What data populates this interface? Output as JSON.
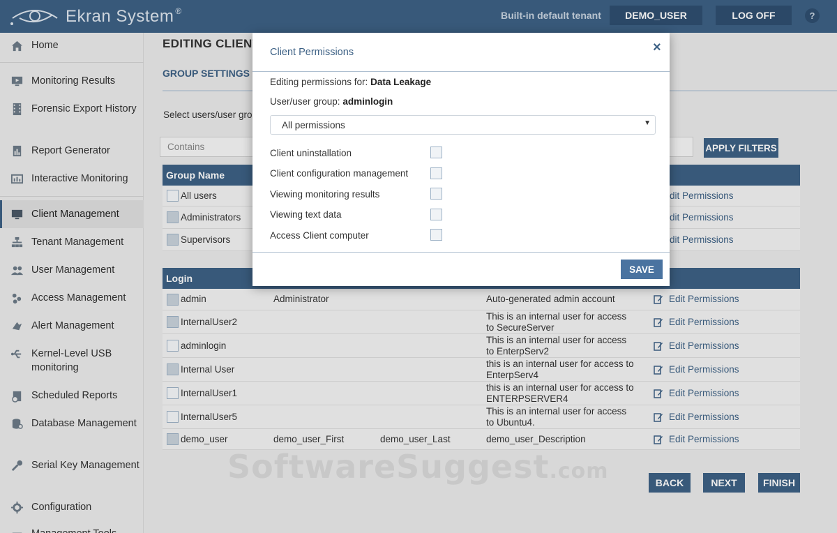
{
  "header": {
    "logo_text": "Ekran System",
    "logo_mark": "®",
    "tenant": "Built-in default tenant",
    "user_button": "DEMO_USER",
    "logoff_button": "LOG OFF",
    "help": "?"
  },
  "sidebar": {
    "items": [
      {
        "label": "Home",
        "icon": "home-icon"
      },
      {
        "label": "Monitoring Results",
        "icon": "monitor-icon"
      },
      {
        "label": "Forensic Export History",
        "icon": "film-icon"
      },
      {
        "label": "Report Generator",
        "icon": "report-icon"
      },
      {
        "label": "Interactive Monitoring",
        "icon": "screen-icon"
      },
      {
        "label": "Client Management",
        "icon": "desktop-icon"
      },
      {
        "label": "Tenant Management",
        "icon": "hierarchy-icon"
      },
      {
        "label": "User Management",
        "icon": "users-icon"
      },
      {
        "label": "Access Management",
        "icon": "access-icon"
      },
      {
        "label": "Alert Management",
        "icon": "alert-icon"
      },
      {
        "label": "Kernel-Level USB monitoring",
        "icon": "usb-icon"
      },
      {
        "label": "Scheduled Reports",
        "icon": "calendar-report-icon"
      },
      {
        "label": "Database Management",
        "icon": "database-icon"
      },
      {
        "label": "Serial Key Management",
        "icon": "key-icon"
      },
      {
        "label": "Configuration",
        "icon": "gear-icon"
      },
      {
        "label": "Management Tools",
        "icon": "tools-icon"
      }
    ]
  },
  "main": {
    "title": "EDITING CLIENT",
    "tab": "GROUP SETTINGS",
    "select_hint": "Select users/user gro",
    "filter_placeholder": "Contains",
    "apply_filters": "APPLY FILTERS",
    "group_table": {
      "header": "Group Name",
      "rows": [
        {
          "name": "All users",
          "checked": false,
          "action": "dit Permissions"
        },
        {
          "name": "Administrators",
          "checked": true,
          "action": "dit Permissions"
        },
        {
          "name": "Supervisors",
          "checked": true,
          "action": "dit Permissions"
        }
      ]
    },
    "user_table": {
      "header": "Login",
      "rows": [
        {
          "login": "admin",
          "first": "Administrator",
          "last": "",
          "desc1": "Auto-generated admin account",
          "desc2": "",
          "checked": true,
          "action": "Edit Permissions"
        },
        {
          "login": "InternalUser2",
          "first": "",
          "last": "",
          "desc1": "This is an internal user for access",
          "desc2": "to SecureServer",
          "checked": true,
          "action": "Edit Permissions"
        },
        {
          "login": "adminlogin",
          "first": "",
          "last": "",
          "desc1": "This is an internal user for access",
          "desc2": "to EnterpServ2",
          "checked": false,
          "action": "Edit Permissions"
        },
        {
          "login": "Internal User",
          "first": "",
          "last": "",
          "desc1": "this is an internal user for access to",
          "desc2": "EnterpServ4",
          "checked": true,
          "action": "Edit Permissions"
        },
        {
          "login": "InternalUser1",
          "first": "",
          "last": "",
          "desc1": "this is an internal user for access to",
          "desc2": "ENTERPSERVER4",
          "checked": false,
          "action": "Edit Permissions"
        },
        {
          "login": "InternalUser5",
          "first": "",
          "last": "",
          "desc1": "This is an internal user for access",
          "desc2": "to Ubuntu4.",
          "checked": false,
          "action": "Edit Permissions"
        },
        {
          "login": "demo_user",
          "first": "demo_user_First",
          "last": "demo_user_Last",
          "desc1": "demo_user_Description",
          "desc2": "",
          "checked": true,
          "action": "Edit Permissions"
        }
      ]
    },
    "buttons": {
      "back": "BACK",
      "next": "NEXT",
      "finish": "FINISH"
    },
    "watermark": "SoftwareSuggest",
    "watermark_suffix": ".com"
  },
  "modal": {
    "title": "Client Permissions",
    "close": "×",
    "editing_label": "Editing permissions for:",
    "editing_value": "Data Leakage",
    "group_label": "User/user group:",
    "group_value": "adminlogin",
    "select_value": "All permissions",
    "select_caret": "▼",
    "permissions": [
      {
        "label": "Client uninstallation",
        "checked": false
      },
      {
        "label": "Client configuration management",
        "checked": false
      },
      {
        "label": "Viewing monitoring results",
        "checked": false
      },
      {
        "label": "Viewing text data",
        "checked": false
      },
      {
        "label": "Access Client computer",
        "checked": false
      }
    ],
    "save": "SAVE"
  },
  "colors": {
    "header_bg": "#3d6185",
    "accent": "#3d6185",
    "sidebar_bg": "#ececec",
    "main_bg": "#ebebeb"
  }
}
